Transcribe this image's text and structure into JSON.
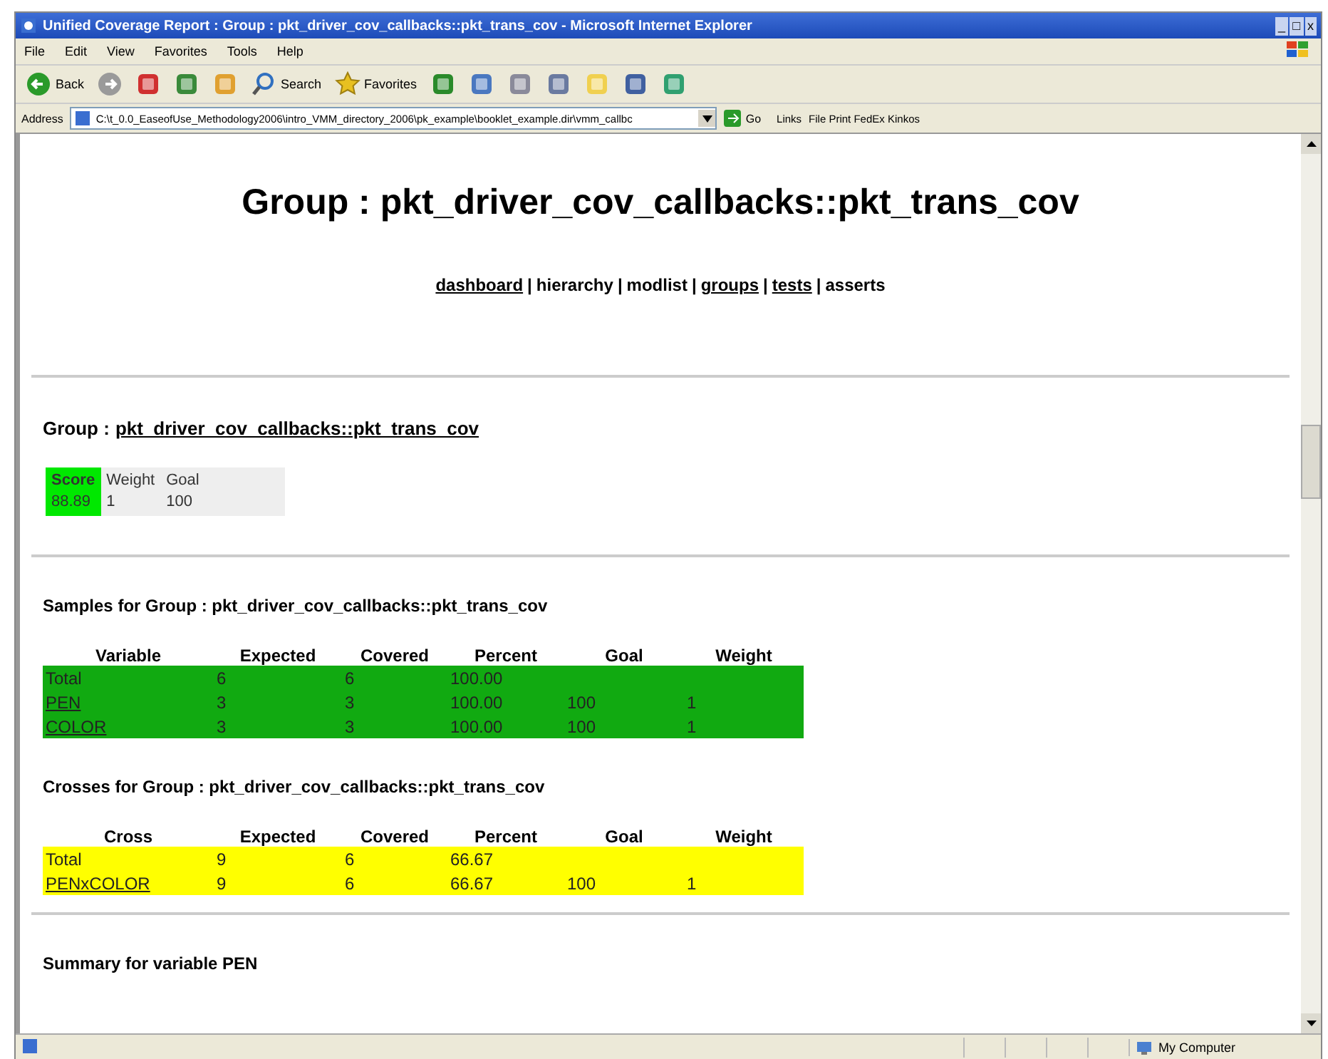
{
  "window": {
    "title": "Unified Coverage Report : Group : pkt_driver_cov_callbacks::pkt_trans_cov - Microsoft Internet Explorer",
    "controls": [
      "_",
      "□",
      "x"
    ]
  },
  "menu": [
    "File",
    "Edit",
    "View",
    "Favorites",
    "Tools",
    "Help"
  ],
  "toolbar": [
    {
      "kind": "back",
      "label": "Back"
    },
    {
      "kind": "forward"
    },
    {
      "kind": "stop"
    },
    {
      "kind": "refresh"
    },
    {
      "kind": "home"
    },
    {
      "kind": "search",
      "label": "Search"
    },
    {
      "kind": "favorites",
      "label": "Favorites"
    },
    {
      "kind": "history"
    },
    {
      "kind": "mail"
    },
    {
      "kind": "print"
    },
    {
      "kind": "edit"
    },
    {
      "kind": "folder"
    },
    {
      "kind": "tool"
    },
    {
      "kind": "messenger"
    }
  ],
  "address": {
    "label": "Address",
    "value": "C:\\t_0.0_EaseofUse_Methodology2006\\intro_VMM_directory_2006\\pk_example\\booklet_example.dir\\vmm_callbc",
    "go": "Go",
    "links": "Links",
    "links_item": "File Print FedEx Kinkos"
  },
  "page": {
    "title": "Group : pkt_driver_cov_callbacks::pkt_trans_cov",
    "nav_separator": "|",
    "nav": [
      {
        "label": "dashboard",
        "link": true
      },
      {
        "label": "hierarchy",
        "link": false
      },
      {
        "label": "modlist",
        "link": false
      },
      {
        "label": "groups",
        "link": true
      },
      {
        "label": "tests",
        "link": true
      },
      {
        "label": "asserts",
        "link": false
      }
    ],
    "group_label": "Group :",
    "group_name": "pkt_driver_cov_callbacks::pkt_trans_cov",
    "score_table": [
      {
        "header": "Score",
        "value": "88.89",
        "highlighted": true
      },
      {
        "header": "Weight",
        "value": "1",
        "highlighted": false
      },
      {
        "header": "Goal",
        "value": "100",
        "highlighted": false
      }
    ],
    "samples": {
      "heading": "Samples for Group : pkt_driver_cov_callbacks::pkt_trans_cov",
      "columns": [
        "Variable",
        "Expected",
        "Covered",
        "Percent",
        "Goal",
        "Weight"
      ],
      "rows": [
        {
          "cells": [
            "Total",
            "6",
            "6",
            "100.00",
            "",
            ""
          ],
          "link": false,
          "color": "#11aa11"
        },
        {
          "cells": [
            "PEN",
            "3",
            "3",
            "100.00",
            "100",
            "1"
          ],
          "link": true,
          "color": "#11aa11"
        },
        {
          "cells": [
            "COLOR",
            "3",
            "3",
            "100.00",
            "100",
            "1"
          ],
          "link": true,
          "color": "#11aa11"
        }
      ]
    },
    "crosses": {
      "heading": "Crosses for Group : pkt_driver_cov_callbacks::pkt_trans_cov",
      "columns": [
        "Cross",
        "Expected",
        "Covered",
        "Percent",
        "Goal",
        "Weight"
      ],
      "rows": [
        {
          "cells": [
            "Total",
            "9",
            "6",
            "66.67",
            "",
            ""
          ],
          "link": false,
          "color": "#ffff00"
        },
        {
          "cells": [
            "PENxCOLOR",
            "9",
            "6",
            "66.67",
            "100",
            "1"
          ],
          "link": true,
          "color": "#ffff00"
        }
      ]
    },
    "summary_heading": "Summary for variable PEN"
  },
  "status_bar": {
    "zone": "My Computer"
  }
}
